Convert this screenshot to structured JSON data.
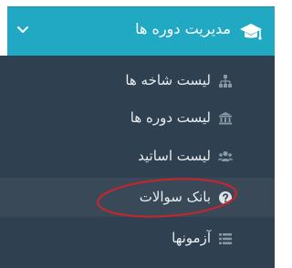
{
  "header": {
    "title": "مدیریت دوره ها",
    "icon": "graduation-cap-icon",
    "toggle_icon": "chevron-down-icon"
  },
  "menu": {
    "items": [
      {
        "label": "لیست شاخه ها",
        "icon": "sitemap-icon"
      },
      {
        "label": "لیست دوره ها",
        "icon": "institution-icon"
      },
      {
        "label": "لیست اساتید",
        "icon": "users-icon"
      },
      {
        "label": "بانک سوالات",
        "icon": "question-circle-icon",
        "active": true
      },
      {
        "label": "آزمونها",
        "icon": "list-icon"
      }
    ]
  },
  "colors": {
    "header_bg": "#21a9c4",
    "menu_bg": "#2f4050",
    "active_bg": "#394958",
    "icon_color": "#8a98a5",
    "annotation": "#c1272d"
  }
}
